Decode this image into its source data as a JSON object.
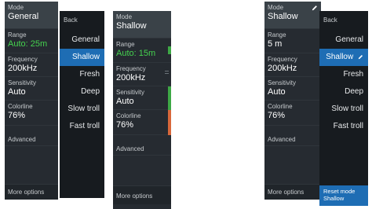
{
  "group1": {
    "side": {
      "mode_label": "Mode",
      "mode_value": "General",
      "range_label": "Range",
      "range_value": "Auto: 25m",
      "freq_label": "Frequency",
      "freq_value": "200kHz",
      "sens_label": "Sensitivity",
      "sens_value": "Auto",
      "color_label": "Colorline",
      "color_value": "76%",
      "advanced": "Advanced",
      "more": "More options"
    },
    "submenu": {
      "back": "Back",
      "items": [
        "General",
        "Shallow",
        "Fresh",
        "Deep",
        "Slow troll",
        "Fast troll"
      ],
      "selected": "Shallow"
    },
    "side2": {
      "mode_label": "Mode",
      "mode_value": "Shallow",
      "range_label": "Range",
      "range_value": "Auto: 15m",
      "freq_label": "Frequency",
      "freq_value": "200kHz",
      "sens_label": "Sensitivity",
      "sens_value": "Auto",
      "color_label": "Colorline",
      "color_value": "76%",
      "advanced": "Advanced",
      "more": "More options"
    }
  },
  "group2": {
    "side": {
      "mode_label": "Mode",
      "mode_value": "Shallow",
      "range_label": "Range",
      "range_value": "5 m",
      "freq_label": "Frequency",
      "freq_value": "200kHz",
      "sens_label": "Sensitivity",
      "sens_value": "Auto",
      "color_label": "Colorline",
      "color_value": "76%",
      "advanced": "Advanced",
      "more": "More options"
    },
    "submenu": {
      "back": "Back",
      "items": [
        "General",
        "Shallow",
        "Fresh",
        "Deep",
        "Slow troll",
        "Fast troll"
      ],
      "selected": "Shallow",
      "reset_line1": "Reset mode",
      "reset_line2": "Shallow"
    }
  },
  "colors": {
    "highlight": "#1e6db4",
    "green": "#45d24f",
    "panel": "#1d2227",
    "strip_green": "#3da845",
    "strip_orange": "#d8673a"
  },
  "icons": [
    "pencil-icon"
  ]
}
